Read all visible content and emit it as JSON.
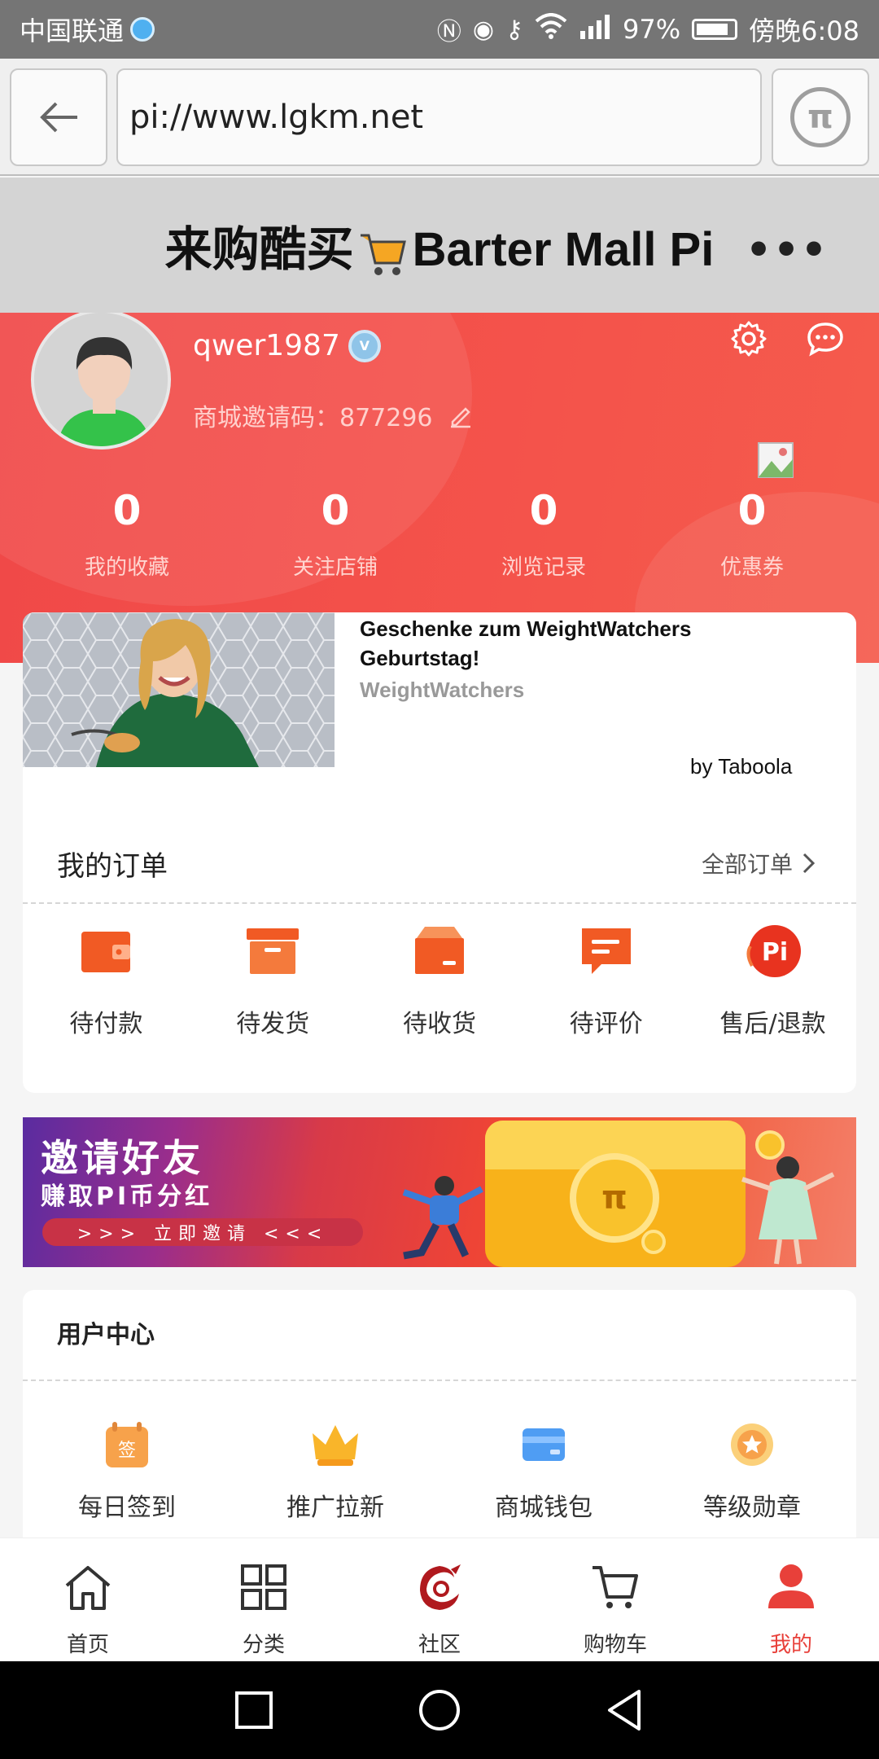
{
  "status_bar": {
    "carrier": "中国联通",
    "battery": "97%",
    "time": "傍晚6:08"
  },
  "browser": {
    "url": "pi://www.lgkm.net"
  },
  "header": {
    "title_cn": "来购酷买",
    "title_en": "Barter Mall Pi"
  },
  "profile": {
    "username": "qwer1987",
    "invite_label": "商城邀请码：",
    "invite_code": "877296",
    "stats": [
      {
        "value": "0",
        "label": "我的收藏"
      },
      {
        "value": "0",
        "label": "关注店铺"
      },
      {
        "value": "0",
        "label": "浏览记录"
      },
      {
        "value": "0",
        "label": "优惠券"
      }
    ]
  },
  "ad": {
    "title": "Geschenke zum WeightWatchers Geburtstag!",
    "source": "WeightWatchers",
    "by": "by Taboola"
  },
  "orders": {
    "title": "我的订单",
    "all_label": "全部订单",
    "items": [
      {
        "label": "待付款",
        "icon": "wallet-icon"
      },
      {
        "label": "待发货",
        "icon": "box-icon"
      },
      {
        "label": "待收货",
        "icon": "package-icon"
      },
      {
        "label": "待评价",
        "icon": "review-icon"
      },
      {
        "label": "售后/退款",
        "icon": "refund-pi-icon"
      }
    ]
  },
  "banner": {
    "line1": "邀请好友",
    "line2": "赚取PI币分红",
    "cta": ">>> 立即邀请 <<<"
  },
  "user_center": {
    "title": "用户中心",
    "items": [
      {
        "label": "每日签到",
        "icon": "checkin-icon"
      },
      {
        "label": "推广拉新",
        "icon": "crown-icon"
      },
      {
        "label": "商城钱包",
        "icon": "wallet-card-icon"
      },
      {
        "label": "等级勋章",
        "icon": "medal-icon"
      }
    ]
  },
  "bottom_nav": {
    "items": [
      {
        "label": "首页",
        "icon": "home-icon"
      },
      {
        "label": "分类",
        "icon": "grid-icon"
      },
      {
        "label": "社区",
        "icon": "community-logo-icon"
      },
      {
        "label": "购物车",
        "icon": "cart-icon"
      },
      {
        "label": "我的",
        "icon": "user-icon"
      }
    ],
    "active_index": 4
  },
  "colors": {
    "accent": "#e8403a",
    "header_red": "#f04848",
    "order_orange": "#f15a24"
  }
}
